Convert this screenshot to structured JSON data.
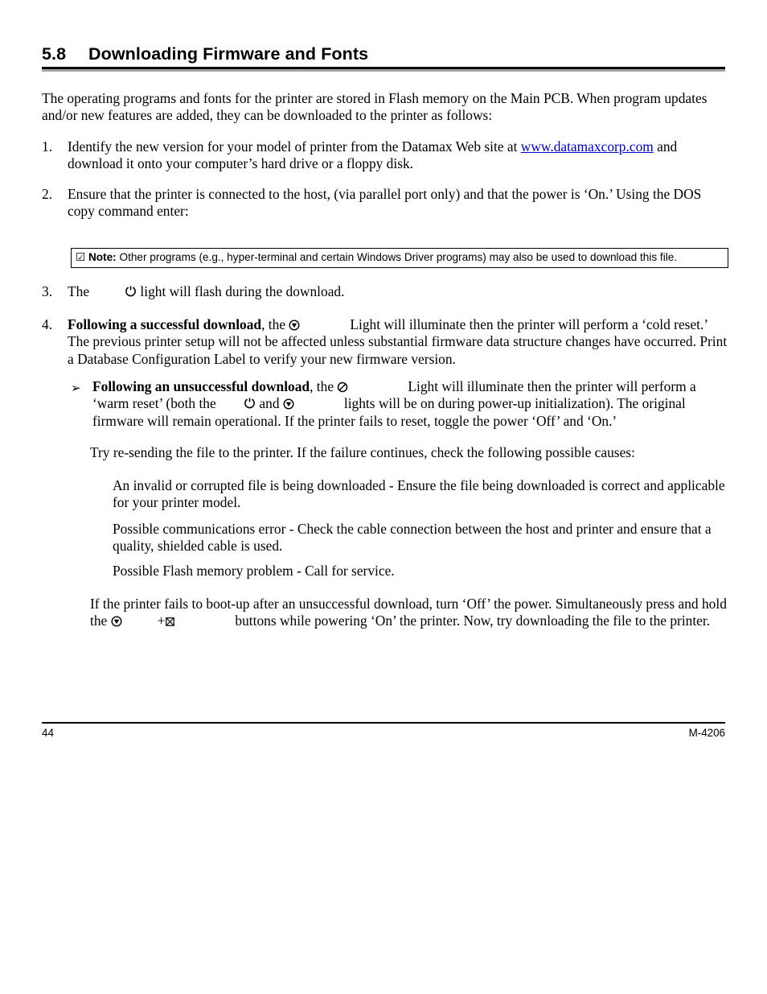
{
  "document": {
    "heading": {
      "number": "5.8",
      "title": "Downloading Firmware and Fonts"
    },
    "intro": "The operating programs and fonts for the printer are stored in Flash memory on the Main PCB. When program updates and/or new features are added, they can be downloaded to the printer as follows:",
    "steps": [
      {
        "number": "1.",
        "text_before_link": "Identify the new version for your model of printer from the Datamax Web site at ",
        "link_text": "www.datamaxcorp.com",
        "text_after_link": " and download it onto your computer’s hard drive or a floppy disk."
      },
      {
        "number": "2.",
        "text": "Ensure that the printer is connected to the host, (via parallel port only) and that the power is ‘On.’ Using the DOS copy command enter:"
      },
      {
        "number": "3.",
        "text_before_icon": "The",
        "icon": "power-light-icon",
        "text_after_icon": "light will flash during the download."
      },
      {
        "number": "4.",
        "bold_lead": "Following a successful download",
        "text_before_icon": ", the ",
        "icon": "feed-light-icon",
        "text_after_icon": "Light will illuminate then the printer will perform a ‘cold reset.’ The previous printer setup will not be affected unless substantial firmware data structure changes have occurred. Print a Database Configuration Label to verify your new firmware version."
      }
    ],
    "note": {
      "check_glyph": "☑",
      "label": "Note:",
      "text": "Other programs (e.g., hyper-terminal and certain Windows  Driver programs) may also be used to download this file."
    },
    "sub_bullet": {
      "marker": "➢",
      "bold_lead": "Following an unsuccessful download",
      "text_1": ", the ",
      "icon_1": "stop-light-icon",
      "text_2": "Light will illuminate then the printer will perform a ‘warm reset’ (both the ",
      "icon_2": "power-light-icon",
      "text_3": " and ",
      "icon_3": "feed-light-icon",
      "text_4": "lights will be on during power-up initialization). The original firmware will remain operational. If the printer fails to reset, toggle the power ‘Off’ and ‘On.’"
    },
    "try_paragraph": "Try re-sending the file to the printer. If the failure continues, check the following possible causes:",
    "causes": [
      "An invalid or corrupted file is being downloaded - Ensure the file being downloaded is correct and applicable for your printer model.",
      "Possible communications error - Check the cable connection between the host and printer and ensure that a quality, shielded cable is used.",
      "Possible Flash memory problem - Call for service."
    ],
    "final_paragraph": {
      "text_1": "If the printer fails to boot-up after an unsuccessful download, turn ‘Off’ the power. Simultaneously press and hold the ",
      "icon_1": "feed-button-icon",
      "plus": "+",
      "icon_2": "cancel-button-icon",
      "text_2": "buttons while powering ‘On’ the printer. Now, try downloading the file to the printer."
    },
    "footer": {
      "page_number": "44",
      "model_code": "M-4206"
    },
    "colors": {
      "link": "#0000cc",
      "rule_dark": "#000000",
      "rule_light": "#a6a6a6",
      "text": "#000000"
    }
  }
}
